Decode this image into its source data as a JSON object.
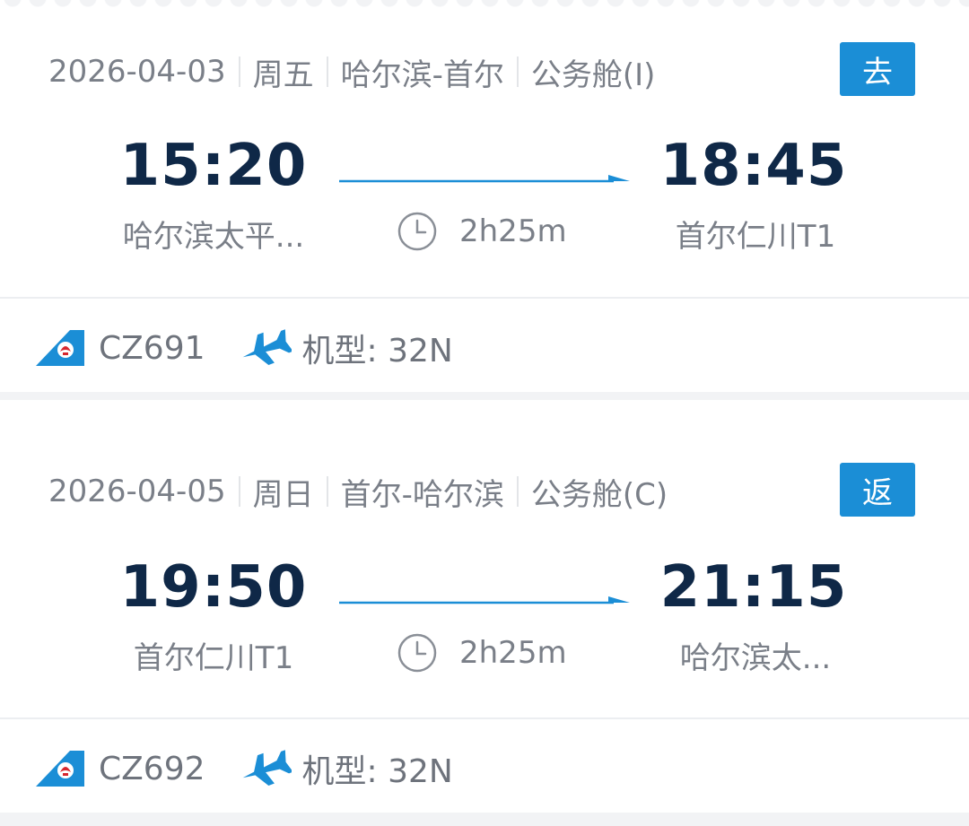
{
  "trips": [
    {
      "date": "2026-04-03",
      "weekday": "周五",
      "route": "哈尔滨-首尔",
      "cabin": "公务舱(I)",
      "direction": "去",
      "dep_time": "15:20",
      "arr_time": "18:45",
      "dep_airport": "哈尔滨太平...",
      "arr_airport": "首尔仁川T1",
      "duration": "2h25m",
      "flight_no": "CZ691",
      "aircraft": "机型: 32N"
    },
    {
      "date": "2026-04-05",
      "weekday": "周日",
      "route": "首尔-哈尔滨",
      "cabin": "公务舱(C)",
      "direction": "返",
      "dep_time": "19:50",
      "arr_time": "21:15",
      "dep_airport": "首尔仁川T1",
      "arr_airport": "哈尔滨太...",
      "duration": "2h25m",
      "flight_no": "CZ692",
      "aircraft": "机型: 32N"
    }
  ],
  "icons": {
    "airline": "china-southern-logo-icon",
    "clock": "clock-icon",
    "plane": "airplane-icon",
    "arrow": "arrow-right-icon"
  },
  "colors": {
    "accent": "#1b8ed6",
    "time": "#0f2847",
    "secondary": "#7a7f88"
  }
}
